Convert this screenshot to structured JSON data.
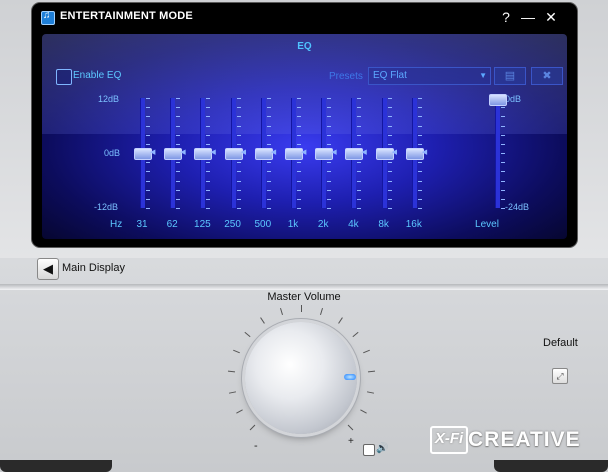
{
  "window": {
    "title": "ENTERTAINMENT MODE",
    "help_label": "?",
    "minimize_label": "—",
    "close_label": "✕"
  },
  "eq": {
    "title": "EQ",
    "enable_label": "Enable EQ",
    "enabled": false,
    "presets_label": "Presets",
    "preset_value": "EQ Flat",
    "save_icon": "save-icon",
    "delete_icon": "delete-icon",
    "scale_top": "12dB",
    "scale_mid": "0dB",
    "scale_bottom": "-12dB",
    "hz_label": "Hz",
    "bands": [
      {
        "label": "31",
        "gain_db": 0
      },
      {
        "label": "62",
        "gain_db": 0
      },
      {
        "label": "125",
        "gain_db": 0
      },
      {
        "label": "250",
        "gain_db": 0
      },
      {
        "label": "500",
        "gain_db": 0
      },
      {
        "label": "1k",
        "gain_db": 0
      },
      {
        "label": "2k",
        "gain_db": 0
      },
      {
        "label": "4k",
        "gain_db": 0
      },
      {
        "label": "8k",
        "gain_db": 0
      },
      {
        "label": "16k",
        "gain_db": 0
      }
    ],
    "level_label": "Level",
    "level_top": "0dB",
    "level_bottom": "-24dB",
    "level_value_db": 0
  },
  "nav": {
    "back_label": "Main Display"
  },
  "master": {
    "label": "Master Volume",
    "minus": "-",
    "plus": "+",
    "volume_fraction": 0.82
  },
  "default": {
    "label": "Default"
  },
  "brand": {
    "xfi": "X-Fi",
    "name": "CREATIVE"
  },
  "colors": {
    "eq_accent": "#4fc3ff",
    "knob_indicator": "#1b7dff"
  }
}
